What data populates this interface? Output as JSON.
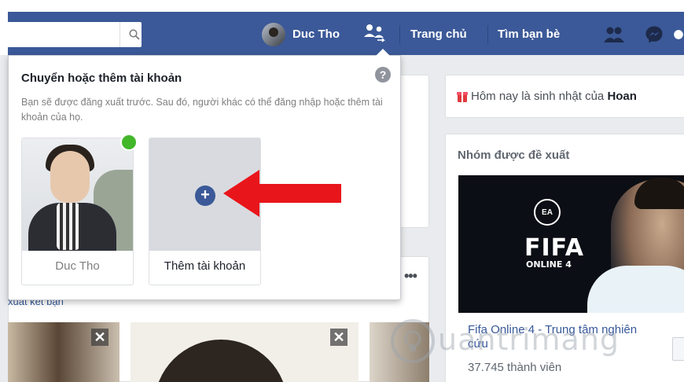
{
  "header": {
    "user_name": "Duc Tho",
    "nav": [
      "Trang chủ",
      "Tìm bạn bè"
    ]
  },
  "switcher": {
    "title": "Chuyển hoặc thêm tài khoản",
    "description": "Bạn sẽ được đăng xuất trước. Sau đó, người khác có thể đăng nhập hoặc thêm tài khoản của họ.",
    "help_label": "?",
    "accounts": [
      {
        "name": "Duc Tho",
        "online": true
      }
    ],
    "add_label": "Thêm tài khoản",
    "plus_glyph": "+"
  },
  "right": {
    "birthday_prefix": "Hôm nay là sinh nhật của ",
    "birthday_name": "Hoan",
    "groups_title": "Nhóm được đề xuất",
    "group": {
      "banner_logo": "EA",
      "banner_title": "FIFA",
      "banner_subtitle": "ONLINE 4",
      "name": "Fifa Online 4 - Trung tâm nghiên cứu",
      "members": "37.745 thành viên"
    }
  },
  "left": {
    "suggest_label": "xuất kết bạn",
    "more_glyph": "•••",
    "close_glyph": "✕"
  },
  "watermark": "uantrimang",
  "colors": {
    "brand_blue": "#3b5998",
    "online_green": "#42b72a",
    "arrow_red": "#e8161b"
  }
}
